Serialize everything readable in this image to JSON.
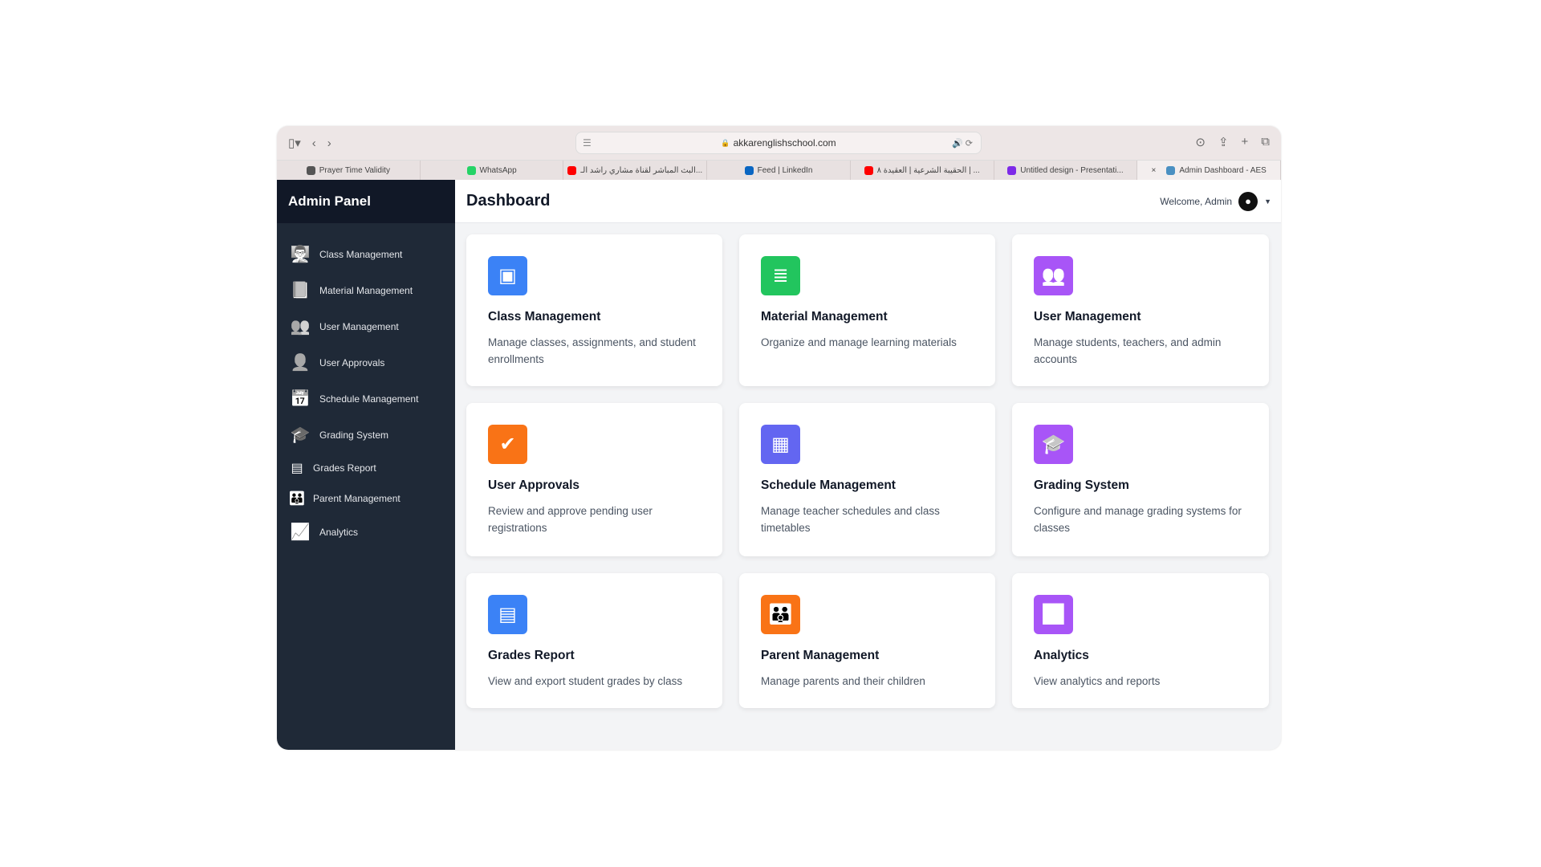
{
  "browser": {
    "url": "akkarenglishschool.com",
    "tabs": [
      {
        "label": "Prayer Time Validity",
        "icon": "gear-icon",
        "color": "#555555"
      },
      {
        "label": "WhatsApp",
        "icon": "whatsapp-icon",
        "color": "#25d366"
      },
      {
        "label": "البث المباشر لقناة مشاري راشد الـ...",
        "icon": "youtube-icon",
        "color": "#ff0000"
      },
      {
        "label": "Feed | LinkedIn",
        "icon": "linkedin-icon",
        "color": "#0a66c2"
      },
      {
        "label": "الحقيبة الشرعية | العقيدة ٨ | ...",
        "icon": "youtube-icon",
        "color": "#ff0000"
      },
      {
        "label": "Untitled design - Presentati...",
        "icon": "canva-icon",
        "color": "#7d2ae8"
      },
      {
        "label": "Admin Dashboard - AES",
        "icon": "site-icon",
        "color": "#4a90c2",
        "active": true
      }
    ]
  },
  "sidebar": {
    "title": "Admin Panel",
    "items": [
      {
        "label": "Class Management",
        "icon": "chalkboard-teacher-icon",
        "glyph": "👨‍🏫"
      },
      {
        "label": "Material Management",
        "icon": "book-icon",
        "glyph": "📘"
      },
      {
        "label": "User Management",
        "icon": "users-icon",
        "glyph": "👥"
      },
      {
        "label": "User Approvals",
        "icon": "user-check-icon",
        "glyph": "👤"
      },
      {
        "label": "Schedule Management",
        "icon": "calendar-icon",
        "glyph": "📅"
      },
      {
        "label": "Grading System",
        "icon": "graduation-cap-icon",
        "glyph": "🎓"
      },
      {
        "label": "Grades Report",
        "icon": "table-icon",
        "glyph": "▤"
      },
      {
        "label": "Parent Management",
        "icon": "user-friends-icon",
        "glyph": "👪"
      },
      {
        "label": "Analytics",
        "icon": "chart-line-icon",
        "glyph": "📈"
      }
    ]
  },
  "header": {
    "title": "Dashboard",
    "welcome": "Welcome, Admin"
  },
  "cards": [
    {
      "title": "Class Management",
      "desc": "Manage classes, assignments, and student enrollments",
      "icon": "chalkboard-teacher-icon",
      "color": "#3b82f6",
      "glyph": "▣"
    },
    {
      "title": "Material Management",
      "desc": "Organize and manage learning materials",
      "icon": "book-icon",
      "color": "#22c55e",
      "glyph": "≣"
    },
    {
      "title": "User Management",
      "desc": "Manage students, teachers, and admin accounts",
      "icon": "users-icon",
      "color": "#a855f7",
      "glyph": "👥"
    },
    {
      "title": "User Approvals",
      "desc": "Review and approve pending user registrations",
      "icon": "user-check-icon",
      "color": "#f97316",
      "glyph": "✔"
    },
    {
      "title": "Schedule Management",
      "desc": "Manage teacher schedules and class timetables",
      "icon": "calendar-icon",
      "color": "#6366f1",
      "glyph": "▦"
    },
    {
      "title": "Grading System",
      "desc": "Configure and manage grading systems for classes",
      "icon": "graduation-cap-icon",
      "color": "#a855f7",
      "glyph": "🎓"
    },
    {
      "title": "Grades Report",
      "desc": "View and export student grades by class",
      "icon": "table-icon",
      "color": "#3b82f6",
      "glyph": "▤"
    },
    {
      "title": "Parent Management",
      "desc": "Manage parents and their children",
      "icon": "user-friends-icon",
      "color": "#f97316",
      "glyph": "👪"
    },
    {
      "title": "Analytics",
      "desc": "View analytics and reports",
      "icon": "chart-line-icon",
      "color": "#a855f7",
      "glyph": "📈"
    }
  ]
}
